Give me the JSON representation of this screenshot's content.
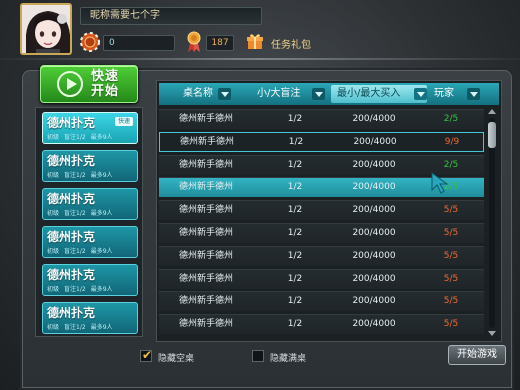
{
  "header": {
    "nickname": "昵称需要七个字",
    "chips": "0",
    "medals": "187",
    "task_gift": "任务礼包"
  },
  "quick_start": {
    "label": "快速\n开始"
  },
  "rooms": [
    {
      "title": "德州扑克",
      "level": "初级",
      "blind": "盲注1/2",
      "max": "最多9人",
      "badge": "快速"
    },
    {
      "title": "德州扑克",
      "level": "初级",
      "blind": "盲注1/2",
      "max": "最多9人"
    },
    {
      "title": "德州扑克",
      "level": "初级",
      "blind": "盲注1/2",
      "max": "最多9人"
    },
    {
      "title": "德州扑克",
      "level": "初级",
      "blind": "盲注1/2",
      "max": "最多9人"
    },
    {
      "title": "德州扑克",
      "level": "初级",
      "blind": "盲注1/2",
      "max": "最多9人"
    },
    {
      "title": "德州扑克",
      "level": "初级",
      "blind": "盲注1/2",
      "max": "最多9人"
    }
  ],
  "table": {
    "columns": [
      "桌名称",
      "小/大盲注",
      "最小/最大买入",
      "玩家"
    ],
    "rows": [
      {
        "name": "德州新手德州",
        "blind": "1/2",
        "buyin": "200/4000",
        "players": "2/5",
        "players_color": "#35c43a"
      },
      {
        "name": "德州新手德州",
        "blind": "1/2",
        "buyin": "200/4000",
        "players": "9/9",
        "players_color": "#ef6a32"
      },
      {
        "name": "德州新手德州",
        "blind": "1/2",
        "buyin": "200/4000",
        "players": "2/5",
        "players_color": "#35c43a"
      },
      {
        "name": "德州新手德州",
        "blind": "1/2",
        "buyin": "200/4000",
        "players": "2/5",
        "players_color": "#35c43a"
      },
      {
        "name": "德州新手德州",
        "blind": "1/2",
        "buyin": "200/4000",
        "players": "5/5",
        "players_color": "#ef6a32"
      },
      {
        "name": "德州新手德州",
        "blind": "1/2",
        "buyin": "200/4000",
        "players": "5/5",
        "players_color": "#ef6a32"
      },
      {
        "name": "德州新手德州",
        "blind": "1/2",
        "buyin": "200/4000",
        "players": "5/5",
        "players_color": "#ef6a32"
      },
      {
        "name": "德州新手德州",
        "blind": "1/2",
        "buyin": "200/4000",
        "players": "5/5",
        "players_color": "#ef6a32"
      },
      {
        "name": "德州新手德州",
        "blind": "1/2",
        "buyin": "200/4000",
        "players": "5/5",
        "players_color": "#ef6a32"
      },
      {
        "name": "德州新手德州",
        "blind": "1/2",
        "buyin": "200/4000",
        "players": "5/5",
        "players_color": "#ef6a32"
      }
    ]
  },
  "footer": {
    "hide_empty": "隐藏空桌",
    "hide_empty_checked": true,
    "hide_full": "隐藏满桌",
    "hide_full_checked": false,
    "start_game": "开始游戏"
  }
}
